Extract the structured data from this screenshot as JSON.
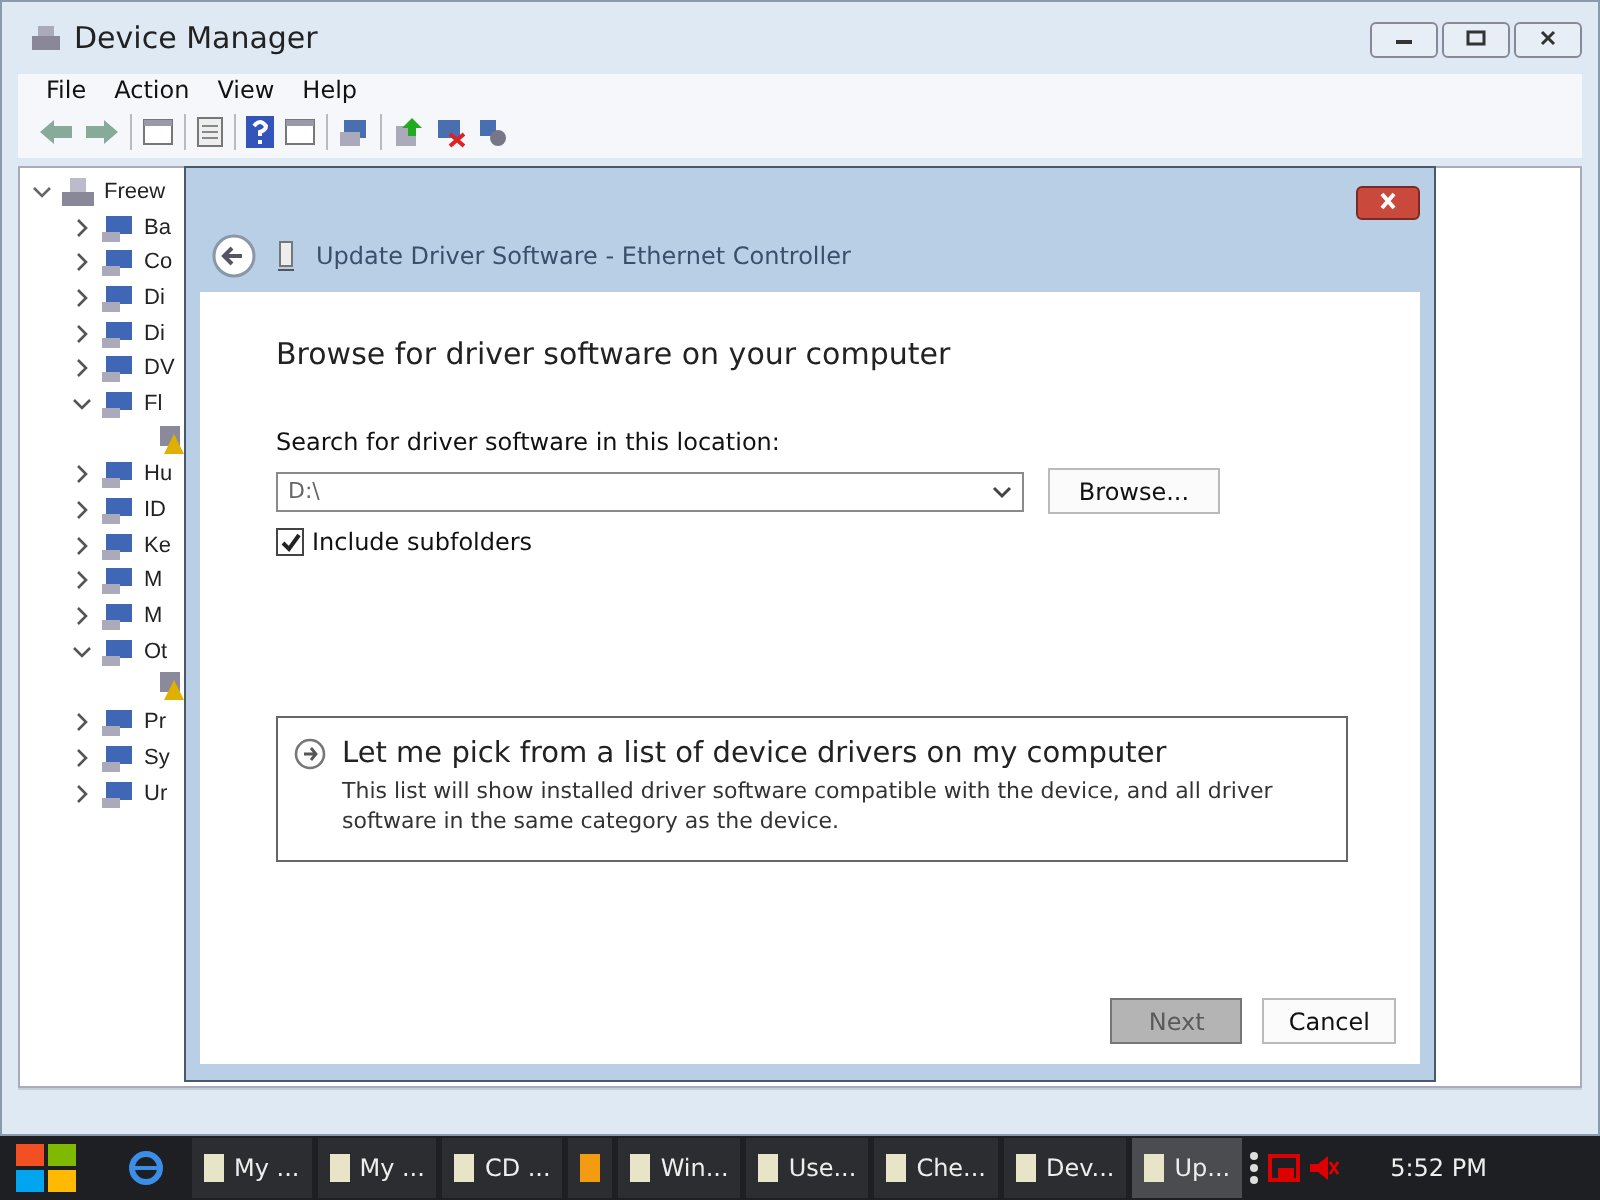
{
  "window": {
    "title": "Device Manager"
  },
  "menu": [
    "File",
    "Action",
    "View",
    "Help"
  ],
  "tree": {
    "label": "Freew",
    "expanded": true,
    "children": [
      {
        "label": "Ba",
        "expanded": false
      },
      {
        "label": "Co",
        "expanded": false
      },
      {
        "label": "Di",
        "expanded": false
      },
      {
        "label": "Di",
        "expanded": false
      },
      {
        "label": "DV",
        "expanded": false
      },
      {
        "label": "Fl",
        "expanded": true,
        "children": [
          {
            "warning": true
          }
        ]
      },
      {
        "label": "Hu",
        "expanded": false
      },
      {
        "label": "ID",
        "expanded": false
      },
      {
        "label": "Ke",
        "expanded": false
      },
      {
        "label": "M",
        "expanded": false
      },
      {
        "label": "M",
        "expanded": false
      },
      {
        "label": "Ot",
        "expanded": true,
        "children": [
          {
            "warning": true
          }
        ]
      },
      {
        "label": "Pr",
        "expanded": false
      },
      {
        "label": "Sy",
        "expanded": false
      },
      {
        "label": "Ur",
        "expanded": false
      }
    ]
  },
  "dialog": {
    "title": "Update Driver Software - Ethernet Controller",
    "heading": "Browse for driver software on your computer",
    "location_label": "Search for driver software in this location:",
    "location_value": "D:\\",
    "browse_button": "Browse...",
    "include_subfolders": {
      "label": "Include subfolders",
      "checked": true
    },
    "pick_option": {
      "title": "Let me pick from a list of device drivers on my computer",
      "description": "This list will show installed driver software compatible with the device, and all driver software in the same category as the device."
    },
    "buttons": [
      {
        "label": "Next",
        "pressed": true
      },
      {
        "label": "Cancel",
        "pressed": false
      }
    ]
  },
  "taskbar": {
    "items": [
      {
        "label": "My ...",
        "selected": false
      },
      {
        "label": "My ...",
        "selected": false
      },
      {
        "label": "CD ...",
        "selected": false
      },
      {
        "selected": false
      },
      {
        "label": "Win...",
        "selected": false
      },
      {
        "label": "Use...",
        "selected": false
      },
      {
        "label": "Che...",
        "selected": false
      },
      {
        "label": "Dev...",
        "selected": false
      },
      {
        "label": "Up...",
        "selected": true
      }
    ],
    "clock": "5:52 PM"
  }
}
